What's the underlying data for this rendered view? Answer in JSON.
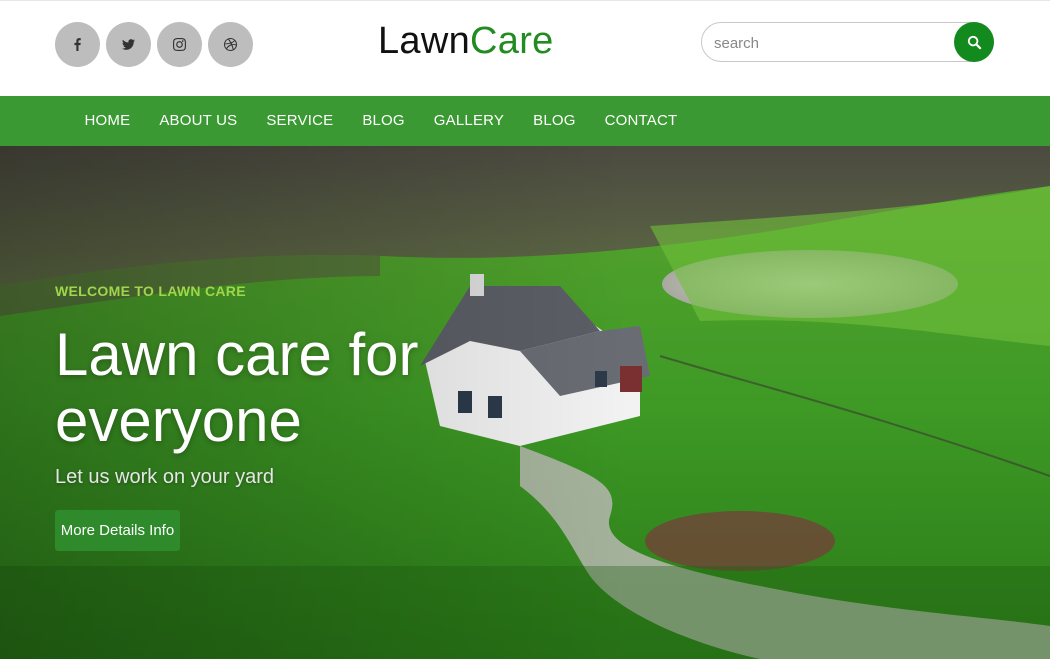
{
  "header": {
    "social": [
      {
        "name": "facebook-icon"
      },
      {
        "name": "twitter-icon"
      },
      {
        "name": "instagram-icon"
      },
      {
        "name": "dribbble-icon"
      }
    ],
    "logo": {
      "part1": "Lawn",
      "part2": "Care"
    },
    "search": {
      "placeholder": "search",
      "icon": "search-icon"
    }
  },
  "nav": {
    "items": [
      {
        "label": "HOME"
      },
      {
        "label": "ABOUT US"
      },
      {
        "label": "SERVICE"
      },
      {
        "label": "BLOG"
      },
      {
        "label": "GALLERY"
      },
      {
        "label": "BLOG"
      },
      {
        "label": "CONTACT"
      }
    ]
  },
  "hero": {
    "welcome": "WELCOME TO LAWN CARE",
    "headline_line1": "Lawn care for",
    "headline_line2": "everyone",
    "subline": "Let us work on your yard",
    "cta_label": "More Details Info"
  },
  "colors": {
    "brand_green": "#228b22",
    "nav_green": "#3a9933",
    "search_button": "#138a1e",
    "welcome_text": "#9fd64a"
  }
}
